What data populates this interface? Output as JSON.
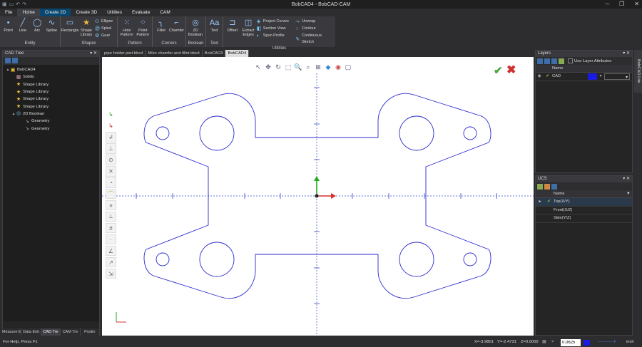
{
  "window": {
    "title": "BobCAD4 - BobCAD-CAM"
  },
  "menu": [
    "File",
    "Home",
    "Create 2D",
    "Create 3D",
    "Utilities",
    "Evaluate",
    "CAM"
  ],
  "ribbon": {
    "entity": {
      "label": "Entity",
      "items": [
        "Point",
        "Line",
        "Arc",
        "Spline"
      ]
    },
    "shapes": {
      "label": "Shapes",
      "items": [
        "Rectangle",
        "Shape Library"
      ],
      "small": [
        "Ellipse",
        "Spiral",
        "Gear"
      ]
    },
    "pattern": {
      "label": "Pattern",
      "items": [
        "Hole Pattern",
        "Point Pattern"
      ]
    },
    "corners": {
      "label": "Corners",
      "items": [
        "Fillet",
        "Chamfer"
      ]
    },
    "boolean": {
      "label": "Boolean",
      "items": [
        "2D Boolean"
      ]
    },
    "text": {
      "label": "Text",
      "items": [
        "Text"
      ]
    },
    "utilities": {
      "label": "Utilities",
      "items": [
        "Offset",
        "Extract Edges"
      ],
      "small": [
        "Project Curves",
        "Section View",
        "Spun Profile",
        "Unwrap",
        "Contour",
        "Continuous Sketch"
      ]
    }
  },
  "cad_tree": {
    "title": "CAD Tree",
    "nodes": [
      {
        "label": "BobCAD4",
        "level": 0,
        "toggle": "▲"
      },
      {
        "label": "Solids",
        "level": 1,
        "toggle": ""
      },
      {
        "label": "Shape Library",
        "level": 1,
        "toggle": ""
      },
      {
        "label": "Shape Library",
        "level": 1,
        "toggle": ""
      },
      {
        "label": "Shape Library",
        "level": 1,
        "toggle": ""
      },
      {
        "label": "Shape Library",
        "level": 1,
        "toggle": ""
      },
      {
        "label": "2D Boolean",
        "level": 1,
        "toggle": "▲"
      },
      {
        "label": "Geometry",
        "level": 2,
        "toggle": ""
      },
      {
        "label": "Geometry",
        "level": 2,
        "toggle": ""
      }
    ],
    "bottom_tabs": [
      "Measure Enti",
      "Data Enti",
      "CAD Tre",
      "CAM Tre",
      "Postin"
    ]
  },
  "doc_tabs": [
    "pipe holder part.bbcd",
    "Mike chamfer and fillet.bbcd",
    "BobCAD3",
    "BobCAD4"
  ],
  "layers": {
    "title": "Layers",
    "use_layer_attr": "Use Layer Attributes",
    "col_name": "Name",
    "rows": [
      {
        "name": "CAD",
        "color": "#1a1ae6"
      }
    ]
  },
  "ucs": {
    "title": "UCS",
    "col_name": "Name",
    "rows": [
      "Top(X/Y)",
      "Front(X/Z)",
      "Side(Y/Z)"
    ]
  },
  "side_tab": "BobCAD Lite",
  "status": {
    "help": "For Help, Press F1",
    "x": "X=-3.9801",
    "y": "Y=-2.4731",
    "z": "Z=0.0000",
    "snap": "0.0625",
    "units": "inch"
  },
  "colors": {
    "geometry": "#2a2ad0",
    "axis_x": "#d43030",
    "axis_y": "#22aa22",
    "accent": "#094771"
  }
}
